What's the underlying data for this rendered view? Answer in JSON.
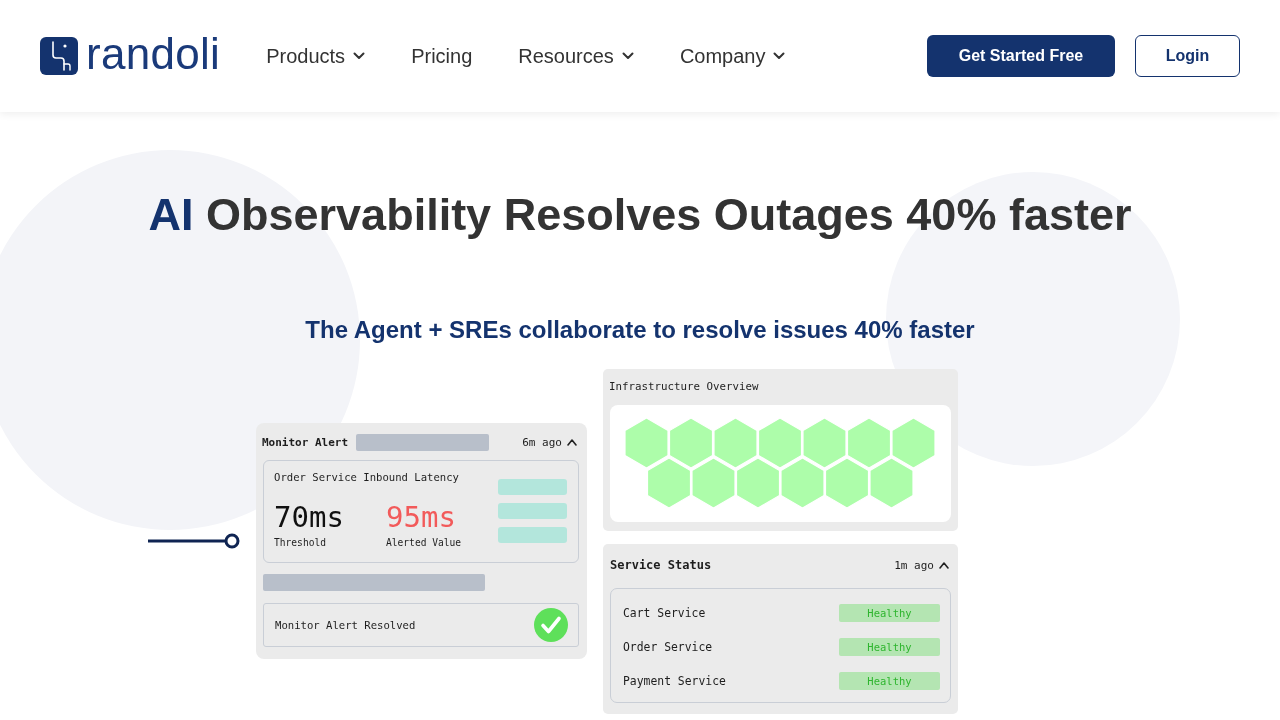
{
  "header": {
    "logo": {
      "text": "randoli"
    },
    "nav": [
      {
        "label": "Products",
        "has_menu": true
      },
      {
        "label": "Pricing",
        "has_menu": false
      },
      {
        "label": "Resources",
        "has_menu": true
      },
      {
        "label": "Company",
        "has_menu": true
      }
    ],
    "buttons": [
      {
        "label": "Get Started Free",
        "kind": "primary"
      },
      {
        "label": "Login",
        "kind": "outline"
      }
    ]
  },
  "hero": {
    "title_accent": "AI",
    "title_rest": "Observability Resolves Outages 40% faster",
    "subtitle": "The Agent + SREs collaborate to resolve issues 40% faster"
  },
  "monitor_alert": {
    "title": "Monitor Alert",
    "time": "6m ago",
    "expanded": true,
    "metric": "Order Service Inbound Latency",
    "threshold": {
      "value": "70ms",
      "label": "Threshold"
    },
    "alerted": {
      "value": "95ms",
      "label": "Alerted Value"
    },
    "resolution": {
      "text": "Monitor Alert Resolved",
      "resolved": true
    }
  },
  "infrastructure": {
    "title": "Infrastructure Overview"
  },
  "service_status": {
    "title": "Service Status",
    "time": "1m ago",
    "expanded": true,
    "services": [
      {
        "name": "Cart Service",
        "status": "Healthy"
      },
      {
        "name": "Order Service",
        "status": "Healthy"
      },
      {
        "name": "Payment Service",
        "status": "Healthy"
      }
    ]
  }
}
